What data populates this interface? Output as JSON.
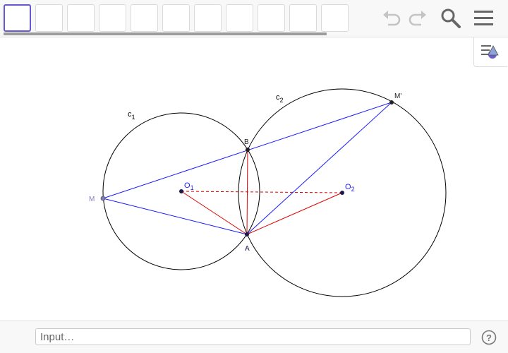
{
  "toolbar": {
    "tool_count": 11,
    "selected_tool": 0
  },
  "icons": {
    "undo": "undo-icon",
    "redo": "redo-icon",
    "search": "search-icon",
    "menu": "menu-icon",
    "style_bar": "style-bar-icon",
    "help": "help-icon"
  },
  "colors": {
    "selected_tool": "#6557d2",
    "segments_blue": "#1a1aff",
    "segments_red": "#e00000",
    "point_dark": "#1a1a4d",
    "point_m": "#7f7fbf"
  },
  "construction": {
    "circle_c1_label": "c",
    "circle_c1_sub": "1",
    "circle_c2_label": "c",
    "circle_c2_sub": "2",
    "point_M": "M",
    "point_Mprime": "M'",
    "point_A": "A",
    "point_B": "B",
    "point_O1": "O",
    "point_O1_sub": "1",
    "point_O2": "O",
    "point_O2_sub": "2"
  },
  "input_bar": {
    "placeholder": "Input…",
    "help_label": "?"
  }
}
